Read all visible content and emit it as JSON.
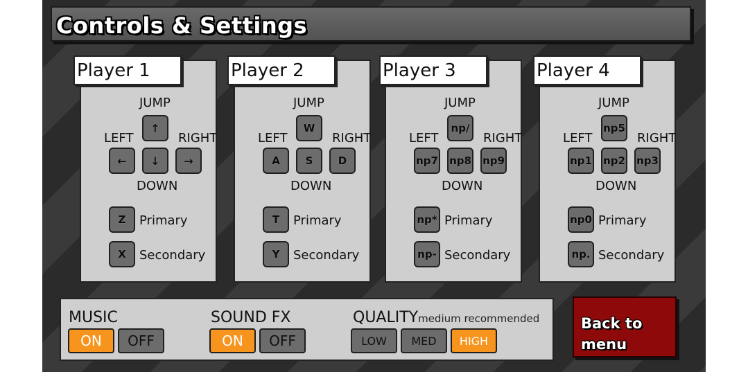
{
  "title": "Controls & Settings",
  "labels": {
    "jump": "JUMP",
    "left": "LEFT",
    "right": "RIGHT",
    "down": "DOWN",
    "primary": "Primary",
    "secondary": "Secondary"
  },
  "players": [
    {
      "name": "Player 1",
      "keys": {
        "jump": "↑",
        "left": "←",
        "down": "↓",
        "right": "→",
        "primary": "Z",
        "secondary": "X"
      }
    },
    {
      "name": "Player 2",
      "keys": {
        "jump": "W",
        "left": "A",
        "down": "S",
        "right": "D",
        "primary": "T",
        "secondary": "Y"
      }
    },
    {
      "name": "Player 3",
      "keys": {
        "jump": "np/",
        "left": "np7",
        "down": "np8",
        "right": "np9",
        "primary": "np*",
        "secondary": "np-"
      }
    },
    {
      "name": "Player 4",
      "keys": {
        "jump": "np5",
        "left": "np1",
        "down": "np2",
        "right": "np3",
        "primary": "np0",
        "secondary": "np."
      }
    }
  ],
  "settings": {
    "music": {
      "label": "MUSIC",
      "on": "ON",
      "off": "OFF",
      "selected": "ON"
    },
    "sound_fx": {
      "label": "SOUND FX",
      "on": "ON",
      "off": "OFF",
      "selected": "ON"
    },
    "quality": {
      "label": "QUALITY",
      "note": "medium recommended",
      "low": "LOW",
      "med": "MED",
      "high": "HIGH",
      "selected": "HIGH"
    }
  },
  "back_button": {
    "line1": "Back to",
    "line2": "menu"
  },
  "colors": {
    "selected": "#f7941d",
    "unselected": "#6c6c6c",
    "back_button": "#8e0a0a"
  }
}
